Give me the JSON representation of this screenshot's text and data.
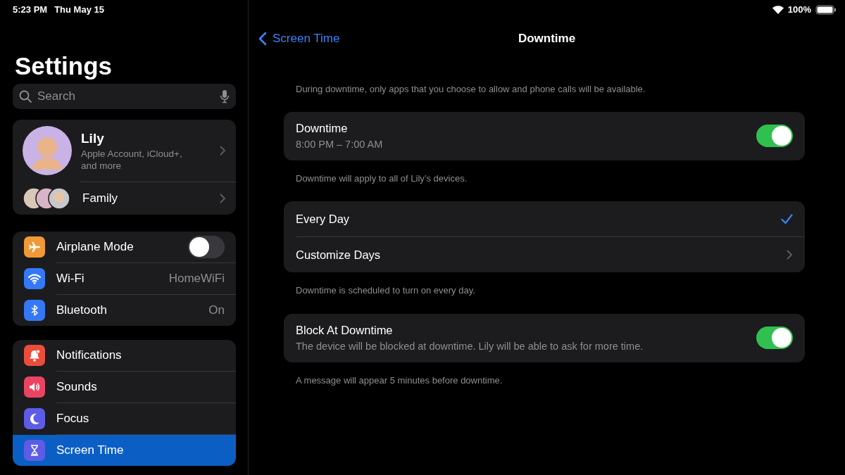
{
  "status_bar": {
    "time": "5:23 PM",
    "date": "Thu May 15",
    "battery": "100%"
  },
  "sidebar": {
    "title": "Settings",
    "search": {
      "placeholder": "Search"
    },
    "account": {
      "name": "Lily",
      "subtitle": "Apple Account, iCloud+, and more"
    },
    "family": {
      "label": "Family"
    },
    "groups": [
      [
        {
          "label": "Airplane Mode",
          "kind": "toggle",
          "on": false,
          "color": "#f09a37",
          "selected": false
        },
        {
          "label": "Wi-Fi",
          "kind": "value",
          "value": "HomeWiFi",
          "color": "#3478f6",
          "selected": false
        },
        {
          "label": "Bluetooth",
          "kind": "value",
          "value": "On",
          "color": "#3478f6",
          "selected": false
        }
      ],
      [
        {
          "label": "Notifications",
          "kind": "nav",
          "color": "#eb4d3d",
          "selected": false
        },
        {
          "label": "Sounds",
          "kind": "nav",
          "color": "#eb4463",
          "selected": false
        },
        {
          "label": "Focus",
          "kind": "nav",
          "color": "#5e5ce6",
          "selected": false
        },
        {
          "label": "Screen Time",
          "kind": "nav",
          "color": "#5e5ce6",
          "selected": true
        }
      ]
    ]
  },
  "detail": {
    "back": "Screen Time",
    "title": "Downtime",
    "intro": "During downtime, only apps that you choose to allow and phone calls will be available.",
    "groups": [
      {
        "rows": [
          {
            "kind": "toggle",
            "title": "Downtime",
            "subtitle": "8:00 PM – 7:00 AM",
            "on": true
          }
        ],
        "footer": "Downtime will apply to all of Lily’s devices."
      },
      {
        "rows": [
          {
            "kind": "option",
            "title": "Every Day",
            "selected": true
          },
          {
            "kind": "nav",
            "title": "Customize Days"
          }
        ],
        "footer": "Downtime is scheduled to turn on every day."
      },
      {
        "rows": [
          {
            "kind": "toggle",
            "title": "Block At Downtime",
            "subtitle": "The device will be blocked at downtime. Lily will be able to ask for more time.",
            "on": true
          }
        ],
        "footer": "A message will appear 5 minutes before downtime."
      }
    ]
  }
}
